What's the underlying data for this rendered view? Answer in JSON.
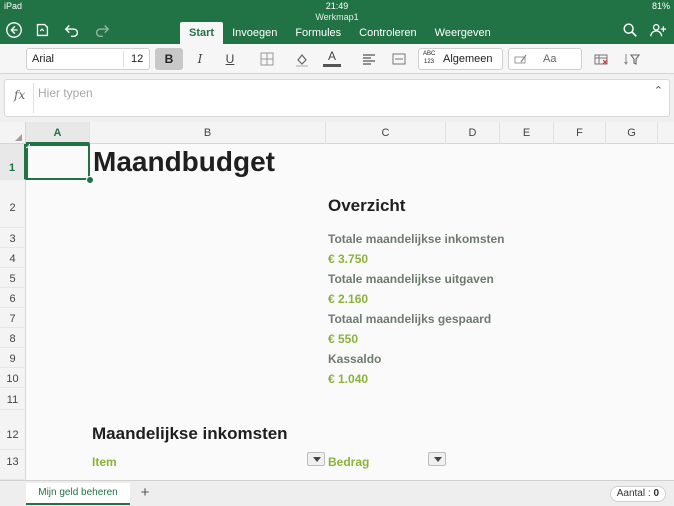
{
  "status": {
    "device": "iPad",
    "time": "21:49",
    "battery": "81%"
  },
  "workbook": {
    "title": "Werkmap1"
  },
  "tabs": [
    {
      "label": "Start",
      "active": true
    },
    {
      "label": "Invoegen"
    },
    {
      "label": "Formules"
    },
    {
      "label": "Controleren"
    },
    {
      "label": "Weergeven"
    }
  ],
  "ribbon": {
    "font_name": "Arial",
    "font_size": "12",
    "bold_label": "B",
    "italic_label": "I",
    "underline_label": "U",
    "font_color_label": "A",
    "number_format_glyph": "ABC 123",
    "number_format": "Algemeen",
    "cell_style_label": "Aa"
  },
  "formula_bar": {
    "fx_label": "fx",
    "placeholder": "Hier typen",
    "value": ""
  },
  "columns": [
    "A",
    "B",
    "C",
    "D",
    "E",
    "F",
    "G"
  ],
  "rows": [
    "1",
    "2",
    "3",
    "4",
    "5",
    "6",
    "7",
    "8",
    "9",
    "10",
    "11",
    "12",
    "13"
  ],
  "sheet": {
    "title": "Maandbudget",
    "overview_heading": "Overzicht",
    "overview": [
      {
        "label": "Totale maandelijkse inkomsten",
        "value": "€ 3.750"
      },
      {
        "label": "Totale maandelijkse uitgaven",
        "value": "€ 2.160"
      },
      {
        "label": "Totaal maandelijks gespaard",
        "value": "€ 550"
      },
      {
        "label": "Kassaldo",
        "value": "€ 1.040"
      }
    ],
    "section_heading": "Maandelijkse inkomsten",
    "table_headers": [
      "Item",
      "Bedrag"
    ]
  },
  "bottom": {
    "sheet_tab": "Mijn geld beheren",
    "add_sheet": "+",
    "count_label": "Aantal : ",
    "count_value": "0"
  },
  "colors": {
    "accent": "#217346",
    "value_green": "#8ab33a",
    "label_gray": "#6f7a70"
  }
}
